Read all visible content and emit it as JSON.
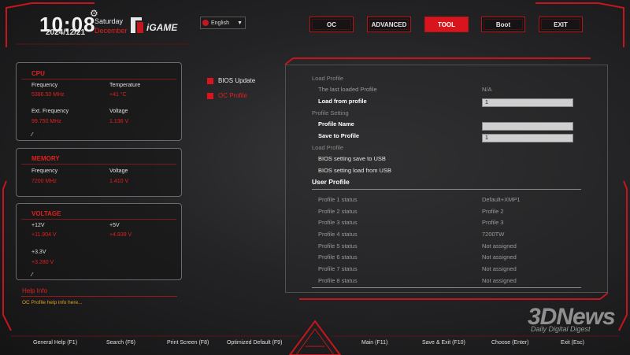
{
  "header": {
    "time": "10:08",
    "date": "2024/12/21",
    "weekday": "Saturday",
    "month": "December",
    "logo_text": "iGAME",
    "language": "English"
  },
  "nav": [
    "OC",
    "ADVANCED",
    "TOOL",
    "Boot",
    "EXIT"
  ],
  "cpu": {
    "title": "CPU",
    "frequency_label": "Frequency",
    "frequency_value": "5386.50 MHz",
    "temperature_label": "Temperature",
    "temperature_value": "+41 °C",
    "ext_label": "Ext. Frequency",
    "ext_value": "99.750 MHz",
    "voltage_label": "Voltage",
    "voltage_value": "1.136 V"
  },
  "memory": {
    "title": "MEMORY",
    "frequency_label": "Frequency",
    "frequency_value": "7200 MHz",
    "voltage_label": "Voltage",
    "voltage_value": "1.410 V"
  },
  "voltage": {
    "title": "VOLTAGE",
    "v12_label": "+12V",
    "v12_value": "+11.904 V",
    "v5_label": "+5V",
    "v5_value": "+4.939 V",
    "v33_label": "+3.3V",
    "v33_value": "+3.280 V"
  },
  "help": {
    "title": "Help Info",
    "text": "OC Profile help info here..."
  },
  "menu": [
    "BIOS Update",
    "OC Profile"
  ],
  "main": {
    "load_profile": "Load Profile",
    "last_loaded_label": "The last loaded Profile",
    "last_loaded_value": "N/A",
    "load_from_label": "Load from profile",
    "load_from_value": "1",
    "profile_setting": "Profile Setting",
    "profile_name_label": "Profile Name",
    "profile_name_value": "",
    "save_to_label": "Save to Profile",
    "save_to_value": "1",
    "load_profile2": "Load Profile",
    "save_usb": "BIOS setting save to USB",
    "load_usb": "BIOS setting load from USB",
    "user_profile": "User Profile",
    "profiles": [
      {
        "label": "Profile 1 status",
        "value": "Default+XMP1"
      },
      {
        "label": "Profile 2 status",
        "value": "Profile 2"
      },
      {
        "label": "Profile 3 status",
        "value": "Profile 3"
      },
      {
        "label": "Profile 4 status",
        "value": "7200TW"
      },
      {
        "label": "Profile 5 status",
        "value": "Not assigned"
      },
      {
        "label": "Profile 6 status",
        "value": "Not assigned"
      },
      {
        "label": "Profile 7 status",
        "value": "Not assigned"
      },
      {
        "label": "Profile 8 status",
        "value": "Not assigned"
      }
    ]
  },
  "footer": [
    "General Help (F1)",
    "Search (F6)",
    "Print Screen (F8)",
    "Optimized Default (F9)",
    "Main (F11)",
    "Save & Exit (F10)",
    "Choose (Enter)",
    "Exit (Esc)"
  ],
  "watermark": {
    "brand": "3DNews",
    "tagline": "Daily Digital Digest"
  },
  "colors": {
    "accent": "#d8141c",
    "value_red": "#e02020",
    "help_text": "#e0a020"
  }
}
